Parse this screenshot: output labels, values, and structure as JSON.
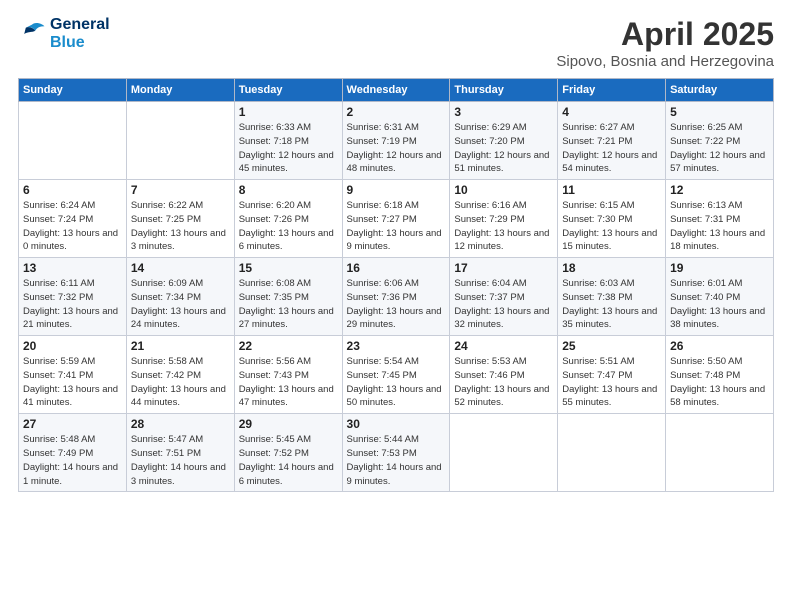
{
  "logo": {
    "line1": "General",
    "line2": "Blue"
  },
  "title": "April 2025",
  "subtitle": "Sipovo, Bosnia and Herzegovina",
  "weekdays": [
    "Sunday",
    "Monday",
    "Tuesday",
    "Wednesday",
    "Thursday",
    "Friday",
    "Saturday"
  ],
  "weeks": [
    [
      {
        "day": "",
        "sunrise": "",
        "sunset": "",
        "daylight": ""
      },
      {
        "day": "",
        "sunrise": "",
        "sunset": "",
        "daylight": ""
      },
      {
        "day": "1",
        "sunrise": "Sunrise: 6:33 AM",
        "sunset": "Sunset: 7:18 PM",
        "daylight": "Daylight: 12 hours and 45 minutes."
      },
      {
        "day": "2",
        "sunrise": "Sunrise: 6:31 AM",
        "sunset": "Sunset: 7:19 PM",
        "daylight": "Daylight: 12 hours and 48 minutes."
      },
      {
        "day": "3",
        "sunrise": "Sunrise: 6:29 AM",
        "sunset": "Sunset: 7:20 PM",
        "daylight": "Daylight: 12 hours and 51 minutes."
      },
      {
        "day": "4",
        "sunrise": "Sunrise: 6:27 AM",
        "sunset": "Sunset: 7:21 PM",
        "daylight": "Daylight: 12 hours and 54 minutes."
      },
      {
        "day": "5",
        "sunrise": "Sunrise: 6:25 AM",
        "sunset": "Sunset: 7:22 PM",
        "daylight": "Daylight: 12 hours and 57 minutes."
      }
    ],
    [
      {
        "day": "6",
        "sunrise": "Sunrise: 6:24 AM",
        "sunset": "Sunset: 7:24 PM",
        "daylight": "Daylight: 13 hours and 0 minutes."
      },
      {
        "day": "7",
        "sunrise": "Sunrise: 6:22 AM",
        "sunset": "Sunset: 7:25 PM",
        "daylight": "Daylight: 13 hours and 3 minutes."
      },
      {
        "day": "8",
        "sunrise": "Sunrise: 6:20 AM",
        "sunset": "Sunset: 7:26 PM",
        "daylight": "Daylight: 13 hours and 6 minutes."
      },
      {
        "day": "9",
        "sunrise": "Sunrise: 6:18 AM",
        "sunset": "Sunset: 7:27 PM",
        "daylight": "Daylight: 13 hours and 9 minutes."
      },
      {
        "day": "10",
        "sunrise": "Sunrise: 6:16 AM",
        "sunset": "Sunset: 7:29 PM",
        "daylight": "Daylight: 13 hours and 12 minutes."
      },
      {
        "day": "11",
        "sunrise": "Sunrise: 6:15 AM",
        "sunset": "Sunset: 7:30 PM",
        "daylight": "Daylight: 13 hours and 15 minutes."
      },
      {
        "day": "12",
        "sunrise": "Sunrise: 6:13 AM",
        "sunset": "Sunset: 7:31 PM",
        "daylight": "Daylight: 13 hours and 18 minutes."
      }
    ],
    [
      {
        "day": "13",
        "sunrise": "Sunrise: 6:11 AM",
        "sunset": "Sunset: 7:32 PM",
        "daylight": "Daylight: 13 hours and 21 minutes."
      },
      {
        "day": "14",
        "sunrise": "Sunrise: 6:09 AM",
        "sunset": "Sunset: 7:34 PM",
        "daylight": "Daylight: 13 hours and 24 minutes."
      },
      {
        "day": "15",
        "sunrise": "Sunrise: 6:08 AM",
        "sunset": "Sunset: 7:35 PM",
        "daylight": "Daylight: 13 hours and 27 minutes."
      },
      {
        "day": "16",
        "sunrise": "Sunrise: 6:06 AM",
        "sunset": "Sunset: 7:36 PM",
        "daylight": "Daylight: 13 hours and 29 minutes."
      },
      {
        "day": "17",
        "sunrise": "Sunrise: 6:04 AM",
        "sunset": "Sunset: 7:37 PM",
        "daylight": "Daylight: 13 hours and 32 minutes."
      },
      {
        "day": "18",
        "sunrise": "Sunrise: 6:03 AM",
        "sunset": "Sunset: 7:38 PM",
        "daylight": "Daylight: 13 hours and 35 minutes."
      },
      {
        "day": "19",
        "sunrise": "Sunrise: 6:01 AM",
        "sunset": "Sunset: 7:40 PM",
        "daylight": "Daylight: 13 hours and 38 minutes."
      }
    ],
    [
      {
        "day": "20",
        "sunrise": "Sunrise: 5:59 AM",
        "sunset": "Sunset: 7:41 PM",
        "daylight": "Daylight: 13 hours and 41 minutes."
      },
      {
        "day": "21",
        "sunrise": "Sunrise: 5:58 AM",
        "sunset": "Sunset: 7:42 PM",
        "daylight": "Daylight: 13 hours and 44 minutes."
      },
      {
        "day": "22",
        "sunrise": "Sunrise: 5:56 AM",
        "sunset": "Sunset: 7:43 PM",
        "daylight": "Daylight: 13 hours and 47 minutes."
      },
      {
        "day": "23",
        "sunrise": "Sunrise: 5:54 AM",
        "sunset": "Sunset: 7:45 PM",
        "daylight": "Daylight: 13 hours and 50 minutes."
      },
      {
        "day": "24",
        "sunrise": "Sunrise: 5:53 AM",
        "sunset": "Sunset: 7:46 PM",
        "daylight": "Daylight: 13 hours and 52 minutes."
      },
      {
        "day": "25",
        "sunrise": "Sunrise: 5:51 AM",
        "sunset": "Sunset: 7:47 PM",
        "daylight": "Daylight: 13 hours and 55 minutes."
      },
      {
        "day": "26",
        "sunrise": "Sunrise: 5:50 AM",
        "sunset": "Sunset: 7:48 PM",
        "daylight": "Daylight: 13 hours and 58 minutes."
      }
    ],
    [
      {
        "day": "27",
        "sunrise": "Sunrise: 5:48 AM",
        "sunset": "Sunset: 7:49 PM",
        "daylight": "Daylight: 14 hours and 1 minute."
      },
      {
        "day": "28",
        "sunrise": "Sunrise: 5:47 AM",
        "sunset": "Sunset: 7:51 PM",
        "daylight": "Daylight: 14 hours and 3 minutes."
      },
      {
        "day": "29",
        "sunrise": "Sunrise: 5:45 AM",
        "sunset": "Sunset: 7:52 PM",
        "daylight": "Daylight: 14 hours and 6 minutes."
      },
      {
        "day": "30",
        "sunrise": "Sunrise: 5:44 AM",
        "sunset": "Sunset: 7:53 PM",
        "daylight": "Daylight: 14 hours and 9 minutes."
      },
      {
        "day": "",
        "sunrise": "",
        "sunset": "",
        "daylight": ""
      },
      {
        "day": "",
        "sunrise": "",
        "sunset": "",
        "daylight": ""
      },
      {
        "day": "",
        "sunrise": "",
        "sunset": "",
        "daylight": ""
      }
    ]
  ]
}
